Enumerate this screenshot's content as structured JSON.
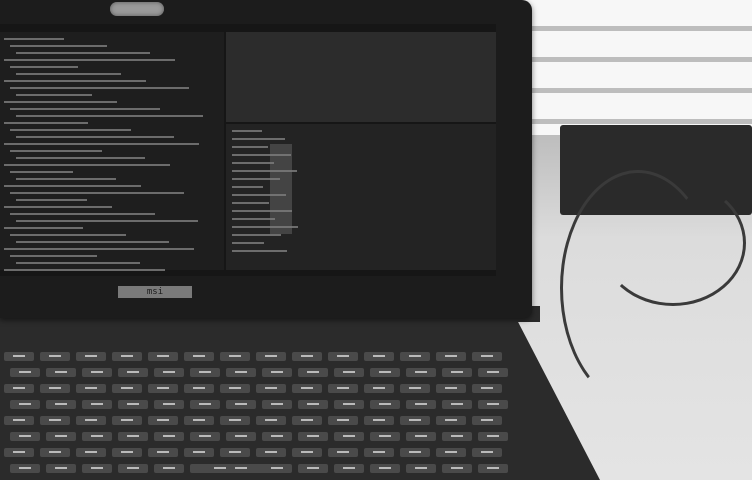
{
  "scene": {
    "description_free": true,
    "laptop_logo_text": "msi"
  },
  "colors": {
    "background": "#cfcfcf",
    "laptop_body": "#1c1c1c",
    "screen": "#161616",
    "key_glyph": "#d6d6d6"
  }
}
